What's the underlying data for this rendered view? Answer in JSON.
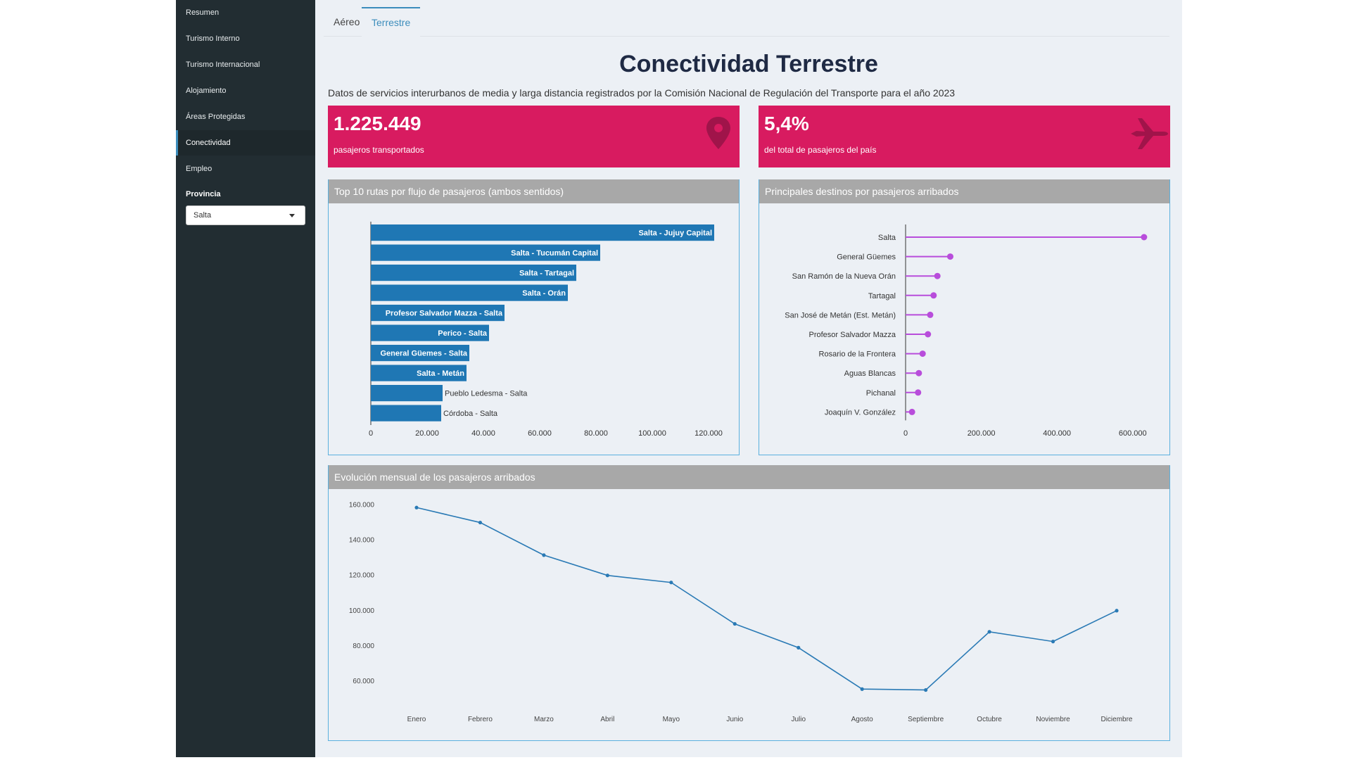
{
  "sidebar": {
    "items": [
      {
        "label": "Resumen"
      },
      {
        "label": "Turismo Interno"
      },
      {
        "label": "Turismo Internacional"
      },
      {
        "label": "Alojamiento"
      },
      {
        "label": "Áreas Protegidas"
      },
      {
        "label": "Conectividad"
      },
      {
        "label": "Empleo"
      }
    ],
    "active_index": 5,
    "province_label": "Provincia",
    "province_value": "Salta"
  },
  "tabs": [
    {
      "label": "Aéreo"
    },
    {
      "label": "Terrestre"
    }
  ],
  "active_tab": 1,
  "page": {
    "title": "Conectividad Terrestre",
    "subtitle": "Datos de servicios interurbanos de media y larga distancia registrados por la Comisión Nacional de Regulación del Transporte para el año 2023"
  },
  "kpis": [
    {
      "value": "1.225.449",
      "label": "pasajeros transportados",
      "icon": "map-marker-icon"
    },
    {
      "value": "5,4%",
      "label": "del total de pasajeros del país",
      "icon": "plane-icon"
    }
  ],
  "colors": {
    "kpi_bg": "#d81b60",
    "bar": "#1f77b4",
    "lollipop": "#b84ddb",
    "line": "#2a7ab5",
    "box_header": "#a8a8a8",
    "box_border": "#5bb0de"
  },
  "boxes": {
    "routes_title": "Top 10 rutas por flujo de pasajeros (ambos sentidos)",
    "destinations_title": "Principales destinos por pasajeros arribados",
    "monthly_title": "Evolución mensual de los pasajeros arribados"
  },
  "chart_data": [
    {
      "type": "bar",
      "orientation": "horizontal",
      "title": "Top 10 rutas por flujo de pasajeros (ambos sentidos)",
      "categories": [
        "Salta - Jujuy Capital",
        "Salta - Tucumán Capital",
        "Salta - Tartagal",
        "Salta - Orán",
        "Profesor Salvador Mazza - Salta",
        "Perico - Salta",
        "General Güemes - Salta",
        "Salta - Metán",
        "Pueblo Ledesma - Salta",
        "Córdoba - Salta"
      ],
      "values": [
        122000,
        81500,
        73000,
        70000,
        47500,
        42000,
        35000,
        34000,
        25500,
        25000
      ],
      "xlim": [
        0,
        130000
      ],
      "xticks": [
        "0",
        "20.000",
        "40.000",
        "60.000",
        "80.000",
        "100.000",
        "120.000"
      ],
      "xtick_values": [
        0,
        20000,
        40000,
        60000,
        80000,
        100000,
        120000
      ]
    },
    {
      "type": "scatter",
      "style": "lollipop",
      "title": "Principales destinos por pasajeros arribados",
      "categories": [
        "Salta",
        "General Güemes",
        "San Ramón de la Nueva Orán",
        "Tartagal",
        "San José de Metán (Est. Metán)",
        "Profesor Salvador Mazza",
        "Rosario de la Frontera",
        "Aguas Blancas",
        "Pichanal",
        "Joaquín V. González"
      ],
      "values": [
        630000,
        118000,
        84000,
        74000,
        65000,
        59000,
        45000,
        35000,
        33000,
        17000
      ],
      "xlim": [
        0,
        660000
      ],
      "xticks": [
        "0",
        "200.000",
        "400.000",
        "600.000"
      ],
      "xtick_values": [
        0,
        200000,
        400000,
        600000
      ]
    },
    {
      "type": "line",
      "title": "Evolución mensual de los pasajeros arribados",
      "x": [
        "Enero",
        "Febrero",
        "Marzo",
        "Abril",
        "Mayo",
        "Junio",
        "Julio",
        "Agosto",
        "Septiembre",
        "Octubre",
        "Noviembre",
        "Diciembre"
      ],
      "y": [
        158500,
        150000,
        131500,
        120000,
        116000,
        92500,
        79000,
        55500,
        55000,
        88000,
        82500,
        100000
      ],
      "ylim": [
        50000,
        165000
      ],
      "yticks": [
        "60.000",
        "80.000",
        "100.000",
        "120.000",
        "140.000",
        "160.000"
      ],
      "ytick_values": [
        60000,
        80000,
        100000,
        120000,
        140000,
        160000
      ]
    }
  ]
}
